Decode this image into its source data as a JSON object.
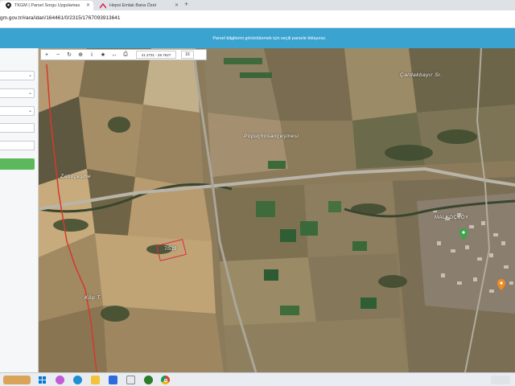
{
  "browser": {
    "tabs": [
      {
        "title": "TKGM | Parsel Sorgu Uygulamas",
        "icon": "location-pin-icon",
        "active": true
      },
      {
        "title": "Hepsi Emlak Bana Özel",
        "icon": "hepsiemlak-logo-icon",
        "active": false
      }
    ],
    "new_tab_label": "+",
    "url": "gm.gov.tr/#ara/idari/164461/0/2315/1767093913641"
  },
  "banner": {
    "text": "Parsel bilgilerini görüntülemek için seçili parsele tıklayınız.",
    "color": "#3aa3d0"
  },
  "sidebar": {
    "search_button_color": "#5cb85c"
  },
  "map_toolbar": {
    "buttons": [
      {
        "name": "zoom-in",
        "glyph": "+"
      },
      {
        "name": "zoom-out",
        "glyph": "−"
      },
      {
        "name": "refresh",
        "glyph": "↻"
      },
      {
        "name": "locate",
        "glyph": "⊕"
      },
      {
        "name": "info",
        "glyph": "i"
      },
      {
        "name": "favorite",
        "glyph": "★"
      },
      {
        "name": "measure",
        "glyph": "↔"
      },
      {
        "name": "print",
        "glyph": "⎙"
      }
    ],
    "coordinates": "41.2731 - 26.7627",
    "zoom_level": "16"
  },
  "map": {
    "labels": {
      "cardakbayir": "Çardakbayır Sr.",
      "popuchosan": "Popuçhosançeşmesi",
      "zabilcesme": "Zabilçeşme",
      "malkockoy": "MALKOÇKÖY",
      "kop": "Köp T."
    },
    "parcel_label": "7/533",
    "parcel_color": "#e0284a"
  },
  "taskbar": {
    "icons": [
      "windows-start-icon",
      "search-icon",
      "task-view-icon",
      "edge-icon",
      "file-explorer-icon",
      "store-icon",
      "mail-icon",
      "chrome-icon"
    ]
  }
}
